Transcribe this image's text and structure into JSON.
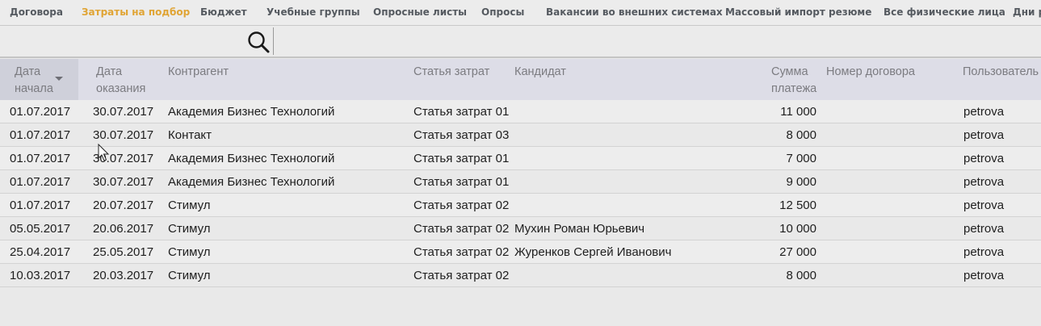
{
  "tabs": [
    {
      "label": "Договора",
      "active": false
    },
    {
      "label": "Затраты на подбор",
      "active": true
    },
    {
      "label": "Бюджет",
      "active": false
    },
    {
      "label": "Учебные группы",
      "active": false
    },
    {
      "label": "Опросные листы",
      "active": false
    },
    {
      "label": "Опросы",
      "active": false
    },
    {
      "label": "Вакансии во внешних системах",
      "active": false
    },
    {
      "label": "Массовый импорт резюме",
      "active": false
    },
    {
      "label": "Все физические лица",
      "active": false
    },
    {
      "label": "Дни р",
      "active": false
    }
  ],
  "search": {
    "value": "",
    "placeholder": ""
  },
  "table": {
    "headers": {
      "start_date": [
        "Дата",
        "начала"
      ],
      "service_date": [
        "Дата",
        "оказания"
      ],
      "contractor": "Контрагент",
      "cost_item": "Статья затрат",
      "candidate": "Кандидат",
      "amount": [
        "Сумма",
        "платежа"
      ],
      "contract_number": "Номер договора",
      "user": "Пользователь"
    },
    "sorted_column": "start_date",
    "sort_direction": "descending",
    "rows": [
      {
        "start_date": "01.07.2017",
        "service_date": "30.07.2017",
        "contractor": "Академия Бизнес Технологий",
        "cost_item": "Статья затрат 01",
        "candidate": "",
        "amount": "11 000",
        "contract_number": "",
        "user": "petrova"
      },
      {
        "start_date": "01.07.2017",
        "service_date": "30.07.2017",
        "contractor": "Контакт",
        "cost_item": "Статья затрат 03",
        "candidate": "",
        "amount": "8 000",
        "contract_number": "",
        "user": "petrova"
      },
      {
        "start_date": "01.07.2017",
        "service_date": "30.07.2017",
        "contractor": "Академия Бизнес Технологий",
        "cost_item": "Статья затрат 01",
        "candidate": "",
        "amount": "7 000",
        "contract_number": "",
        "user": "petrova"
      },
      {
        "start_date": "01.07.2017",
        "service_date": "30.07.2017",
        "contractor": "Академия Бизнес Технологий",
        "cost_item": "Статья затрат 01",
        "candidate": "",
        "amount": "9 000",
        "contract_number": "",
        "user": "petrova"
      },
      {
        "start_date": "01.07.2017",
        "service_date": "20.07.2017",
        "contractor": "Стимул",
        "cost_item": "Статья затрат 02",
        "candidate": "",
        "amount": "12 500",
        "contract_number": "",
        "user": "petrova"
      },
      {
        "start_date": "05.05.2017",
        "service_date": "20.06.2017",
        "contractor": "Стимул",
        "cost_item": "Статья затрат 02",
        "candidate": "Мухин Роман Юрьевич",
        "amount": "10 000",
        "contract_number": "",
        "user": "petrova"
      },
      {
        "start_date": "25.04.2017",
        "service_date": "25.05.2017",
        "contractor": "Стимул",
        "cost_item": "Статья затрат 02",
        "candidate": "Журенков Сергей Иванович",
        "amount": "27 000",
        "contract_number": "",
        "user": "petrova"
      },
      {
        "start_date": "10.03.2017",
        "service_date": "20.03.2017",
        "contractor": "Стимул",
        "cost_item": "Статья затрат 02",
        "candidate": "",
        "amount": "8 000",
        "contract_number": "",
        "user": "petrova"
      }
    ]
  },
  "icons": {
    "search": "search-icon",
    "sort": "sort-desc-arrow-icon",
    "cursor": "mouse-pointer-icon"
  },
  "colors": {
    "active_tab": "#e0a434",
    "tab": "#555a60",
    "header_bg": "#dddde7",
    "header_text": "#7b7b80"
  }
}
